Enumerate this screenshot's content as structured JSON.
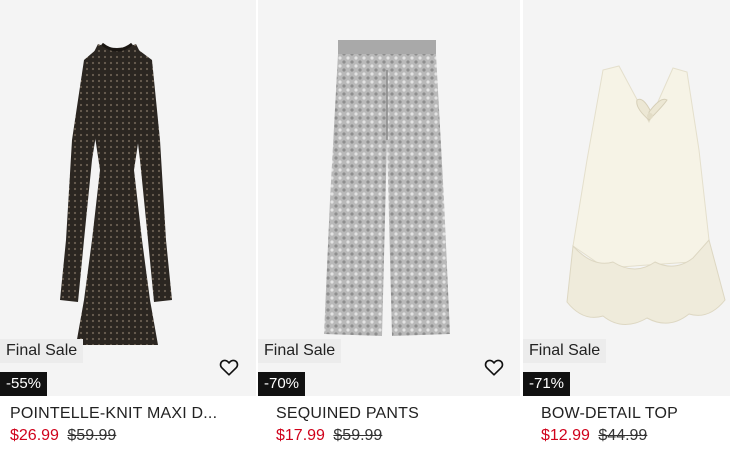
{
  "products": [
    {
      "sale_badge": "Final Sale",
      "discount": "-55%",
      "title": "POINTELLE-KNIT MAXI D...",
      "sale_price": "$26.99",
      "original_price": "$59.99",
      "favorite_icon": "heart-outline-icon",
      "image": "black pointelle-knit maxi dress"
    },
    {
      "sale_badge": "Final Sale",
      "discount": "-70%",
      "title": "SEQUINED PANTS",
      "sale_price": "$17.99",
      "original_price": "$59.99",
      "favorite_icon": "heart-outline-icon",
      "image": "silver sequined pants"
    },
    {
      "sale_badge": "Final Sale",
      "discount": "-71%",
      "title": "BOW-DETAIL TOP",
      "sale_price": "$12.99",
      "original_price": "$44.99",
      "image": "cream bow-detail top"
    }
  ],
  "colors": {
    "sale_price": "#d0021b",
    "badge_bg": "#ececec",
    "discount_bg": "#111111",
    "image_bg": "#f4f4f4"
  }
}
